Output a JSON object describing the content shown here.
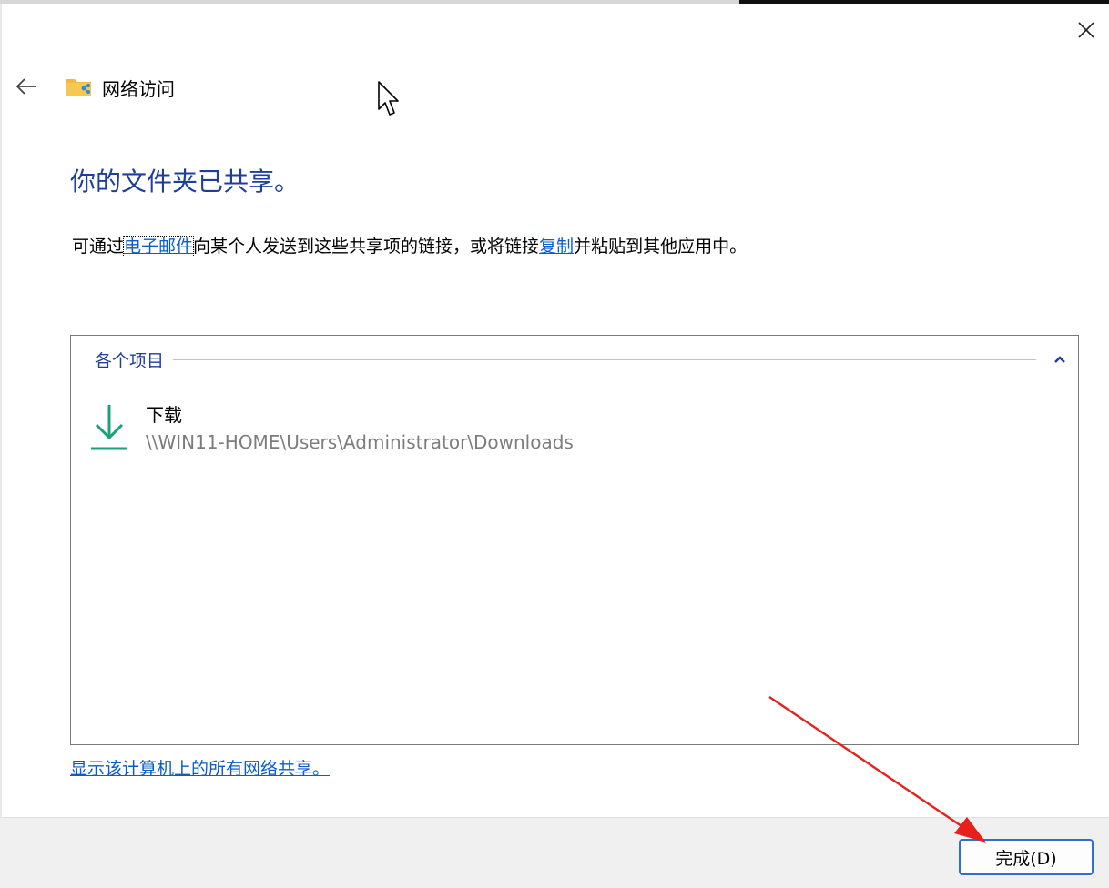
{
  "window": {
    "title": "网络访问"
  },
  "headline": "你的文件夹已共享。",
  "description": {
    "prefix": "可通过",
    "email_link": "电子邮件",
    "middle": "向某个人发送到这些共享项的链接，或将链接",
    "copy_link": "复制",
    "suffix": "并粘贴到其他应用中。"
  },
  "items": {
    "group_title": "各个项目",
    "list": [
      {
        "name": "下载",
        "path": "\\\\WIN11-HOME\\Users\\Administrator\\Downloads",
        "icon": "download-icon"
      }
    ]
  },
  "show_all_link": "显示该计算机上的所有网络共享。",
  "footer": {
    "done_label": "完成(D)"
  },
  "colors": {
    "headline": "#1e3e9a",
    "link": "#0b5ccb",
    "download_icon": "#1aa37a",
    "annotation_arrow": "#e8201c",
    "button_border": "#2f6fcf"
  }
}
